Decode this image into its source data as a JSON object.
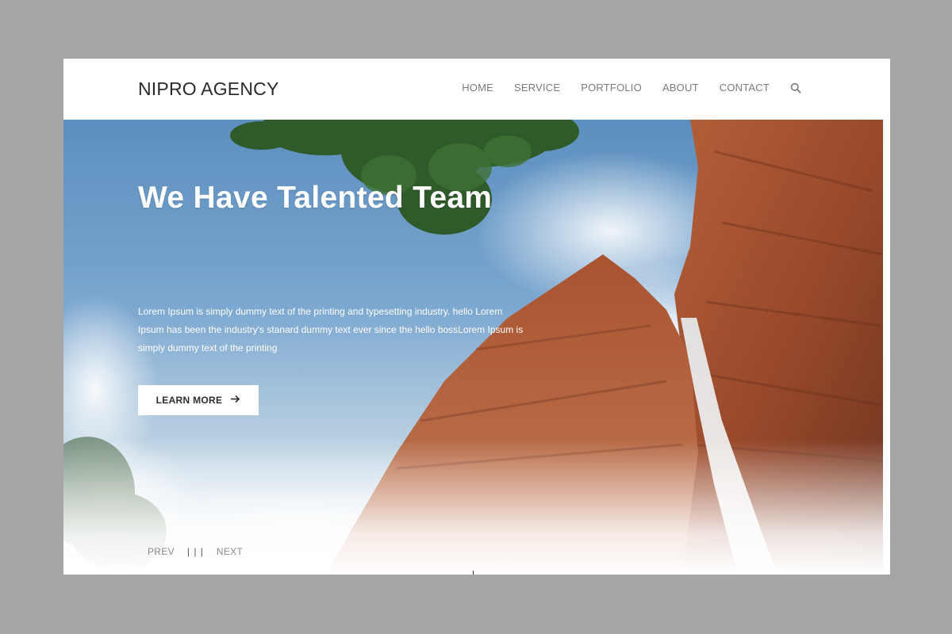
{
  "header": {
    "logo": "NIPRO AGENCY",
    "nav": [
      "HOME",
      "SERVICE",
      "PORTFOLIO",
      "ABOUT",
      "CONTACT"
    ],
    "search_icon": "search-icon"
  },
  "hero": {
    "title": "We Have Talented Team",
    "text": "Lorem Ipsum is simply dummy text of the printing and typesetting industry. hello Lorem Ipsum has been the industry's stanard dummy text ever since the hello bossLorem Ipsum is simply dummy text of the printing",
    "button_label": "LEARN MORE",
    "button_icon": "arrow-right-icon"
  },
  "pager": {
    "prev": "PREV",
    "separator": "| | |",
    "next": "NEXT"
  },
  "colors": {
    "background": "#a6a6a6",
    "text_dark": "#2b2b2b",
    "nav_text": "#7b7b7b",
    "hero_text": "#ffffff"
  }
}
